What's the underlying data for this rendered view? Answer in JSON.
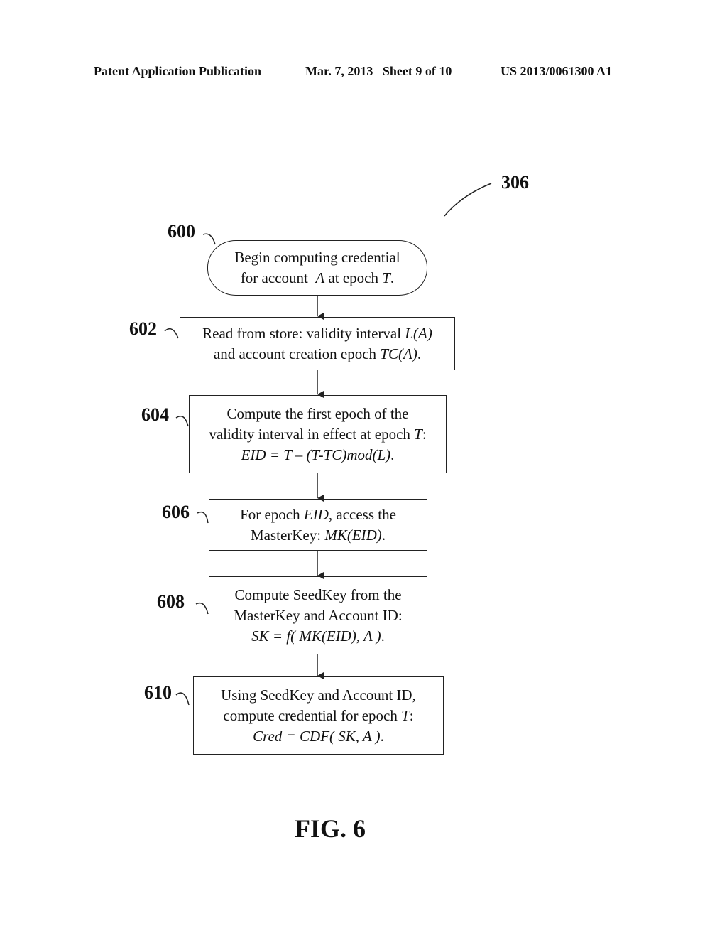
{
  "header": {
    "left": "Patent Application Publication",
    "middle": "Mar. 7, 2013   Sheet 9 of 10",
    "right": "US 2013/0061300 A1"
  },
  "figure_ref": "306",
  "steps": [
    {
      "ref": "600",
      "type": "terminal",
      "lines": [
        [
          {
            "t": "Begin computing credential"
          }
        ],
        [
          {
            "t": "for account  "
          },
          {
            "t": "A",
            "i": true
          },
          {
            "t": " at epoch "
          },
          {
            "t": "T",
            "i": true
          },
          {
            "t": "."
          }
        ]
      ]
    },
    {
      "ref": "602",
      "type": "process",
      "lines": [
        [
          {
            "t": "Read from store: validity interval "
          },
          {
            "t": "L(A)",
            "i": true
          }
        ],
        [
          {
            "t": "and account creation epoch "
          },
          {
            "t": "TC(A)",
            "i": true
          },
          {
            "t": "."
          }
        ]
      ]
    },
    {
      "ref": "604",
      "type": "process",
      "lines": [
        [
          {
            "t": "Compute the first epoch of the"
          }
        ],
        [
          {
            "t": "validity interval in effect at epoch "
          },
          {
            "t": "T",
            "i": true
          },
          {
            "t": ":"
          }
        ],
        [
          {
            "t": "EID = T – (T-TC)mod(L)",
            "i": true
          },
          {
            "t": "."
          }
        ]
      ]
    },
    {
      "ref": "606",
      "type": "process",
      "lines": [
        [
          {
            "t": "For epoch "
          },
          {
            "t": "EID",
            "i": true
          },
          {
            "t": ", access the"
          }
        ],
        [
          {
            "t": "MasterKey: "
          },
          {
            "t": "MK(EID)",
            "i": true
          },
          {
            "t": "."
          }
        ]
      ]
    },
    {
      "ref": "608",
      "type": "process",
      "lines": [
        [
          {
            "t": "Compute SeedKey from the"
          }
        ],
        [
          {
            "t": "MasterKey and Account ID:"
          }
        ],
        [
          {
            "t": "SK = f( MK(EID), A )",
            "i": true
          },
          {
            "t": "."
          }
        ]
      ]
    },
    {
      "ref": "610",
      "type": "process",
      "lines": [
        [
          {
            "t": "Using SeedKey and Account ID,"
          }
        ],
        [
          {
            "t": "compute credential for epoch "
          },
          {
            "t": "T",
            "i": true
          },
          {
            "t": ":"
          }
        ],
        [
          {
            "t": "Cred = CDF( SK, A )",
            "i": true
          },
          {
            "t": "."
          }
        ]
      ]
    }
  ],
  "caption": "FIG. 6"
}
